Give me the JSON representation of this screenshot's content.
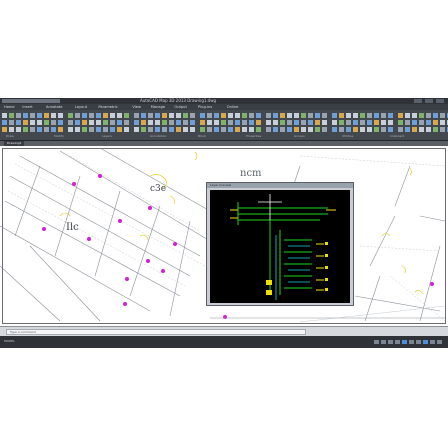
{
  "window": {
    "title": "AutoCAD Map 3D 2013  Drawing1.dwg"
  },
  "ribbon": {
    "tabs": [
      "Home",
      "Insert",
      "Annotate",
      "Layout",
      "Parametric",
      "View",
      "Manage",
      "Output",
      "Plug-ins",
      "Online"
    ],
    "panels": [
      "Draw",
      "Modify",
      "Layers",
      "Annotation",
      "Block",
      "Properties",
      "Groups",
      "Utilities",
      "Clipboard"
    ]
  },
  "file_tabs": [
    "Drawing1"
  ],
  "drawing_labels": {
    "a": "ncm",
    "b": "c3e",
    "c": "Ilc"
  },
  "viewer": {
    "title": "Layer preview"
  },
  "command_line": {
    "placeholder": "Type a command"
  },
  "status": {
    "coords": "MODEL"
  },
  "colors": {
    "accent_pink": "#d41fd4",
    "yellow": "#f0e000",
    "green": "#1fd61f",
    "cyan": "#19d8d8",
    "black": "#000000"
  }
}
